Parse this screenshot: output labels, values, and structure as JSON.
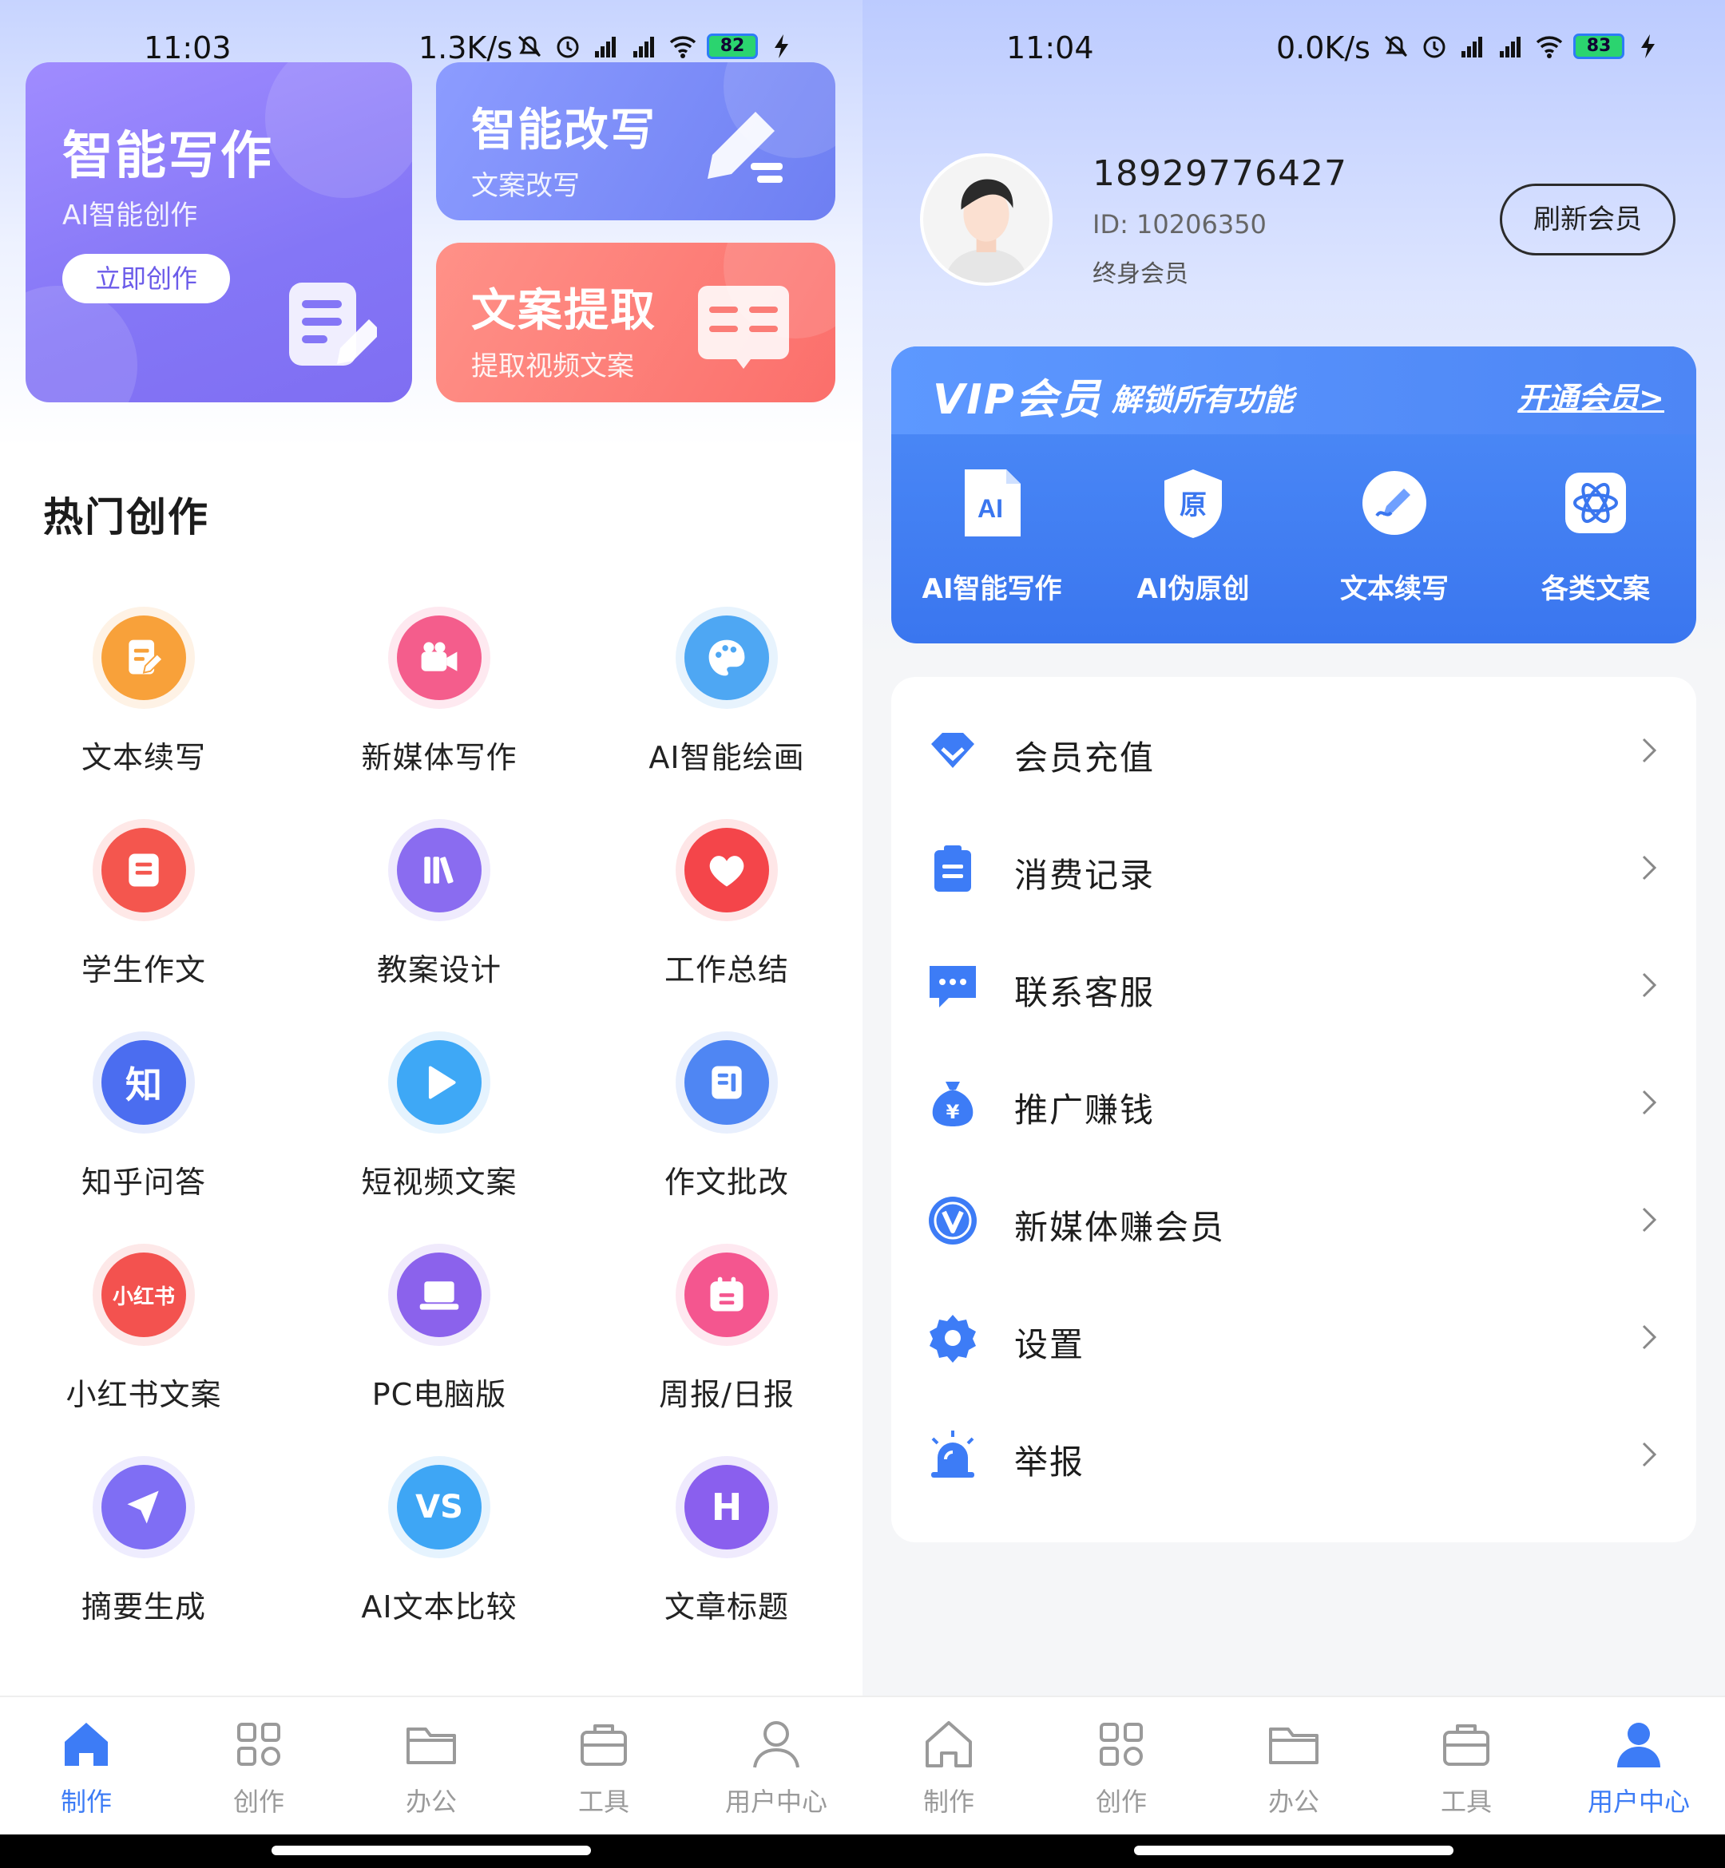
{
  "left": {
    "status": {
      "time": "11:03",
      "speed": "1.3K/s",
      "battery": "82"
    },
    "cards": {
      "write": {
        "title": "智能写作",
        "subtitle": "AI智能创作",
        "button": "立即创作"
      },
      "rewrite": {
        "title": "智能改写",
        "subtitle": "文案改写"
      },
      "extract": {
        "title": "文案提取",
        "subtitle": "提取视频文案"
      }
    },
    "section_title": "热门创作",
    "grid": [
      {
        "label": "文本续写",
        "icon": "doc-edit-icon",
        "color": "#f8a13a"
      },
      {
        "label": "新媒体写作",
        "icon": "video-camera-icon",
        "color": "#f45d8c"
      },
      {
        "label": "AI智能绘画",
        "icon": "palette-icon",
        "color": "#4ea7f3"
      },
      {
        "label": "学生作文",
        "icon": "notebook-icon",
        "color": "#f4564e"
      },
      {
        "label": "教案设计",
        "icon": "books-icon",
        "color": "#8a6cf0"
      },
      {
        "label": "工作总结",
        "icon": "heart-icon",
        "color": "#f4454a"
      },
      {
        "label": "知乎问答",
        "icon": "zhihu-icon",
        "color": "#4b6df0",
        "text": "知"
      },
      {
        "label": "短视频文案",
        "icon": "play-icon",
        "color": "#3ea8f6"
      },
      {
        "label": "作文批改",
        "icon": "document-icon",
        "color": "#4f86f3"
      },
      {
        "label": "小红书文案",
        "icon": "xiaohongshu-icon",
        "color": "#f3524f",
        "text": "小红书"
      },
      {
        "label": "PC电脑版",
        "icon": "laptop-icon",
        "color": "#8b62ec"
      },
      {
        "label": "周报/日报",
        "icon": "calendar-icon",
        "color": "#f4568f"
      },
      {
        "label": "摘要生成",
        "icon": "paper-plane-icon",
        "color": "#7f6ef4"
      },
      {
        "label": "AI文本比较",
        "icon": "vs-icon",
        "color": "#3ea6f5",
        "text": "VS"
      },
      {
        "label": "文章标题",
        "icon": "heading-icon",
        "color": "#8a5fee",
        "text": "H"
      }
    ],
    "nav": [
      {
        "label": "制作",
        "icon": "home-icon",
        "active": true
      },
      {
        "label": "创作",
        "icon": "grid-icon",
        "active": false
      },
      {
        "label": "办公",
        "icon": "folder-icon",
        "active": false
      },
      {
        "label": "工具",
        "icon": "toolbox-icon",
        "active": false
      },
      {
        "label": "用户中心",
        "icon": "user-icon",
        "active": false
      }
    ]
  },
  "right": {
    "status": {
      "time": "11:04",
      "speed": "0.0K/s",
      "battery": "83"
    },
    "profile": {
      "phone": "18929776427",
      "id_label": "ID: 10206350",
      "member_type": "终身会员",
      "refresh_button": "刷新会员"
    },
    "vip": {
      "title": "VIP会员",
      "slogan": "解锁所有功能",
      "open_link": "开通会员>",
      "features": [
        {
          "label": "AI智能写作",
          "icon": "ai-doc-icon"
        },
        {
          "label": "AI伪原创",
          "icon": "original-shield-icon"
        },
        {
          "label": "文本续写",
          "icon": "pen-circle-icon"
        },
        {
          "label": "各类文案",
          "icon": "atom-icon"
        }
      ]
    },
    "menu": [
      {
        "label": "会员充值",
        "icon": "diamond-icon"
      },
      {
        "label": "消费记录",
        "icon": "clipboard-icon"
      },
      {
        "label": "联系客服",
        "icon": "chat-icon"
      },
      {
        "label": "推广赚钱",
        "icon": "money-bag-icon"
      },
      {
        "label": "新媒体赚会员",
        "icon": "v-badge-icon"
      },
      {
        "label": "设置",
        "icon": "settings-gear-icon"
      },
      {
        "label": "举报",
        "icon": "alarm-icon"
      }
    ],
    "nav": [
      {
        "label": "制作",
        "icon": "home-icon",
        "active": false
      },
      {
        "label": "创作",
        "icon": "grid-icon",
        "active": false
      },
      {
        "label": "办公",
        "icon": "folder-icon",
        "active": false
      },
      {
        "label": "工具",
        "icon": "toolbox-icon",
        "active": false
      },
      {
        "label": "用户中心",
        "icon": "user-icon",
        "active": true
      }
    ]
  },
  "colors": {
    "accent": "#3d7cf6",
    "inactive": "#9a9a9a"
  }
}
